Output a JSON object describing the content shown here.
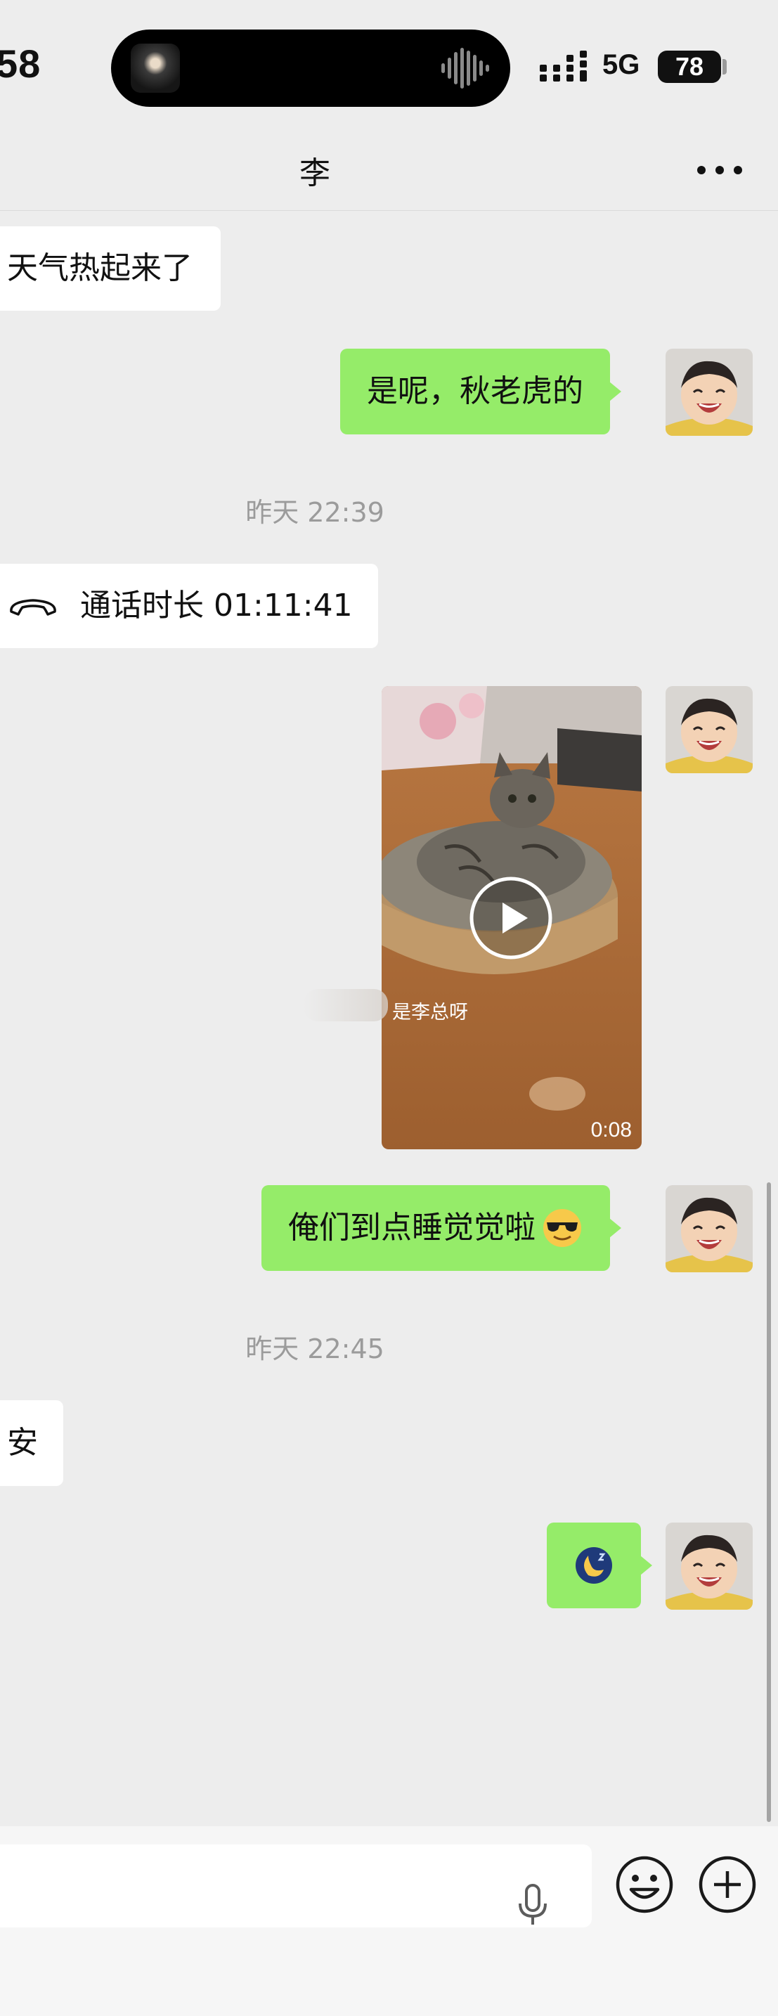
{
  "status_bar": {
    "time": "58",
    "network": "5G",
    "battery": "78"
  },
  "header": {
    "title": "李"
  },
  "messages": {
    "m1": {
      "direction": "incoming",
      "text": "天气热起来了"
    },
    "m2": {
      "direction": "outgoing",
      "text": "是呢，秋老虎的"
    },
    "ts1": "昨天 22:39",
    "m3": {
      "direction": "incoming",
      "type": "call",
      "text": "通话时长 01:11:41"
    },
    "m4": {
      "direction": "outgoing",
      "type": "video",
      "duration": "0:08",
      "watermark": "是李总呀"
    },
    "m5": {
      "direction": "outgoing",
      "text": "俺们到点睡觉觉啦",
      "emoji": "sunglasses-emoji"
    },
    "ts2": "昨天 22:45",
    "m6": {
      "direction": "incoming",
      "text": "安"
    },
    "m7": {
      "direction": "outgoing",
      "type": "sticker",
      "emoji": "moon-sleep-emoji"
    }
  },
  "colors": {
    "background": "#ededed",
    "outgoing_bubble": "#95ec69",
    "incoming_bubble": "#ffffff",
    "timestamp_text": "#9b9b9b"
  },
  "input_bar": {
    "icons": [
      "microphone-icon",
      "emoji-icon",
      "plus-icon"
    ]
  }
}
